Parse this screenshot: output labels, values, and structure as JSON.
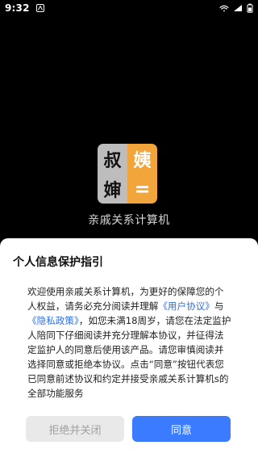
{
  "status_bar": {
    "time": "9:32",
    "left_icon": "notification-icon",
    "wifi_icon": "wifi-icon",
    "signal_icon": "cellular-signal-icon",
    "battery_icon": "battery-icon"
  },
  "app": {
    "name": "亲戚关系计算机",
    "logo_chars": [
      "叔",
      "姨",
      "婶",
      "="
    ]
  },
  "dialog": {
    "title": "个人信息保护指引",
    "body_part1": "欢迎使用亲戚关系计算机，为更好的保障您的个人权益，请务必充分阅读并理解",
    "link_user_agreement": "《用户协议》",
    "body_part2": "与",
    "link_privacy_policy": "《隐私政策》",
    "body_part3": "，如您未满18周岁，请您在法定监护人陪同下仔细阅读并充分理解本协议，并征得法定监护人的同意后使用该产品。请您审慎阅读并选择同意或拒绝本协议。点击“同意”按钮代表您已同意前述协议和约定并接受亲戚关系计算机s的全部功能服务",
    "reject_label": "拒绝并关闭",
    "agree_label": "同意"
  },
  "colors": {
    "accent": "#3a7bff",
    "link": "#2f6fe8",
    "logo_gray": "#bdbdbd",
    "logo_orange": "#f2a53a",
    "background": "#000000"
  }
}
